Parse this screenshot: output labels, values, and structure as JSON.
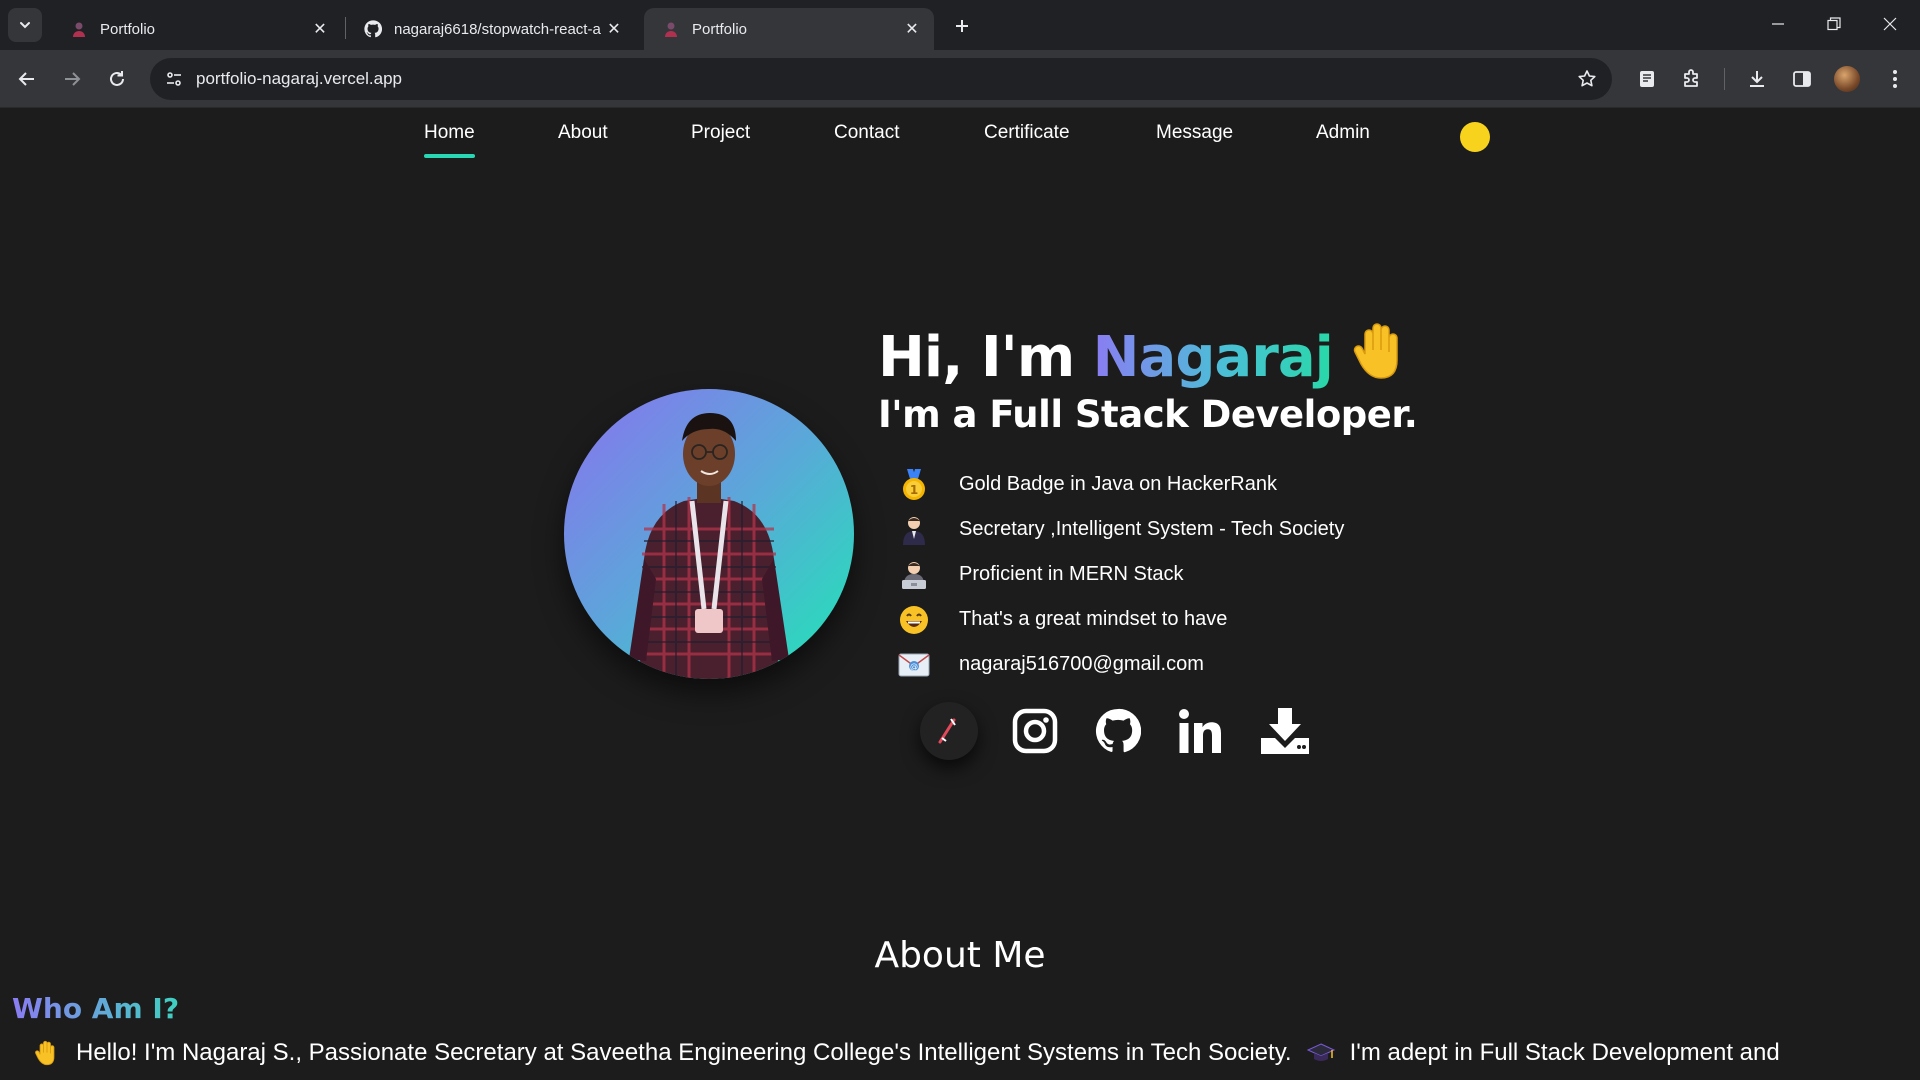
{
  "browser": {
    "tabs": [
      {
        "title": "Portfolio",
        "active": false
      },
      {
        "title": "nagaraj6618/stopwatch-react-a",
        "active": false
      },
      {
        "title": "Portfolio",
        "active": true
      }
    ],
    "url": "portfolio-nagaraj.vercel.app"
  },
  "nav": {
    "items": [
      "Home",
      "About",
      "Project",
      "Contact",
      "Certificate",
      "Message",
      "Admin"
    ],
    "active": "Home",
    "toggle_color": "#f8d31e"
  },
  "hero": {
    "greeting": "Hi, I'm ",
    "name": "Nagaraj",
    "wave": "👋",
    "subtitle": "I'm a Full Stack Developer.",
    "facts": [
      {
        "icon": "medal-icon",
        "text": "Gold Badge in Java on HackerRank"
      },
      {
        "icon": "person-icon",
        "text": "Secretary ,Intelligent System - Tech Society"
      },
      {
        "icon": "technologist-icon",
        "text": "Proficient in MERN Stack"
      },
      {
        "icon": "grin-icon",
        "text": "That's a great mindset to have"
      },
      {
        "icon": "email-icon",
        "text": "nagaraj516700@gmail.com"
      }
    ],
    "socials": [
      "dev-badge-icon",
      "instagram-icon",
      "github-icon",
      "linkedin-icon",
      "download-icon"
    ]
  },
  "about": {
    "heading": "About Me",
    "subheading": "Who Am I?",
    "intro_part1": "Hello! I'm Nagaraj S., Passionate Secretary at Saveetha Engineering College's Intelligent Systems in Tech Society.",
    "intro_part2": "I'm adept in Full Stack Development and"
  },
  "colors": {
    "accent": "#2ad7b4",
    "gradient_start": "#8b7cf3",
    "gradient_end": "#28d8a8",
    "background": "#1c1c1c"
  }
}
